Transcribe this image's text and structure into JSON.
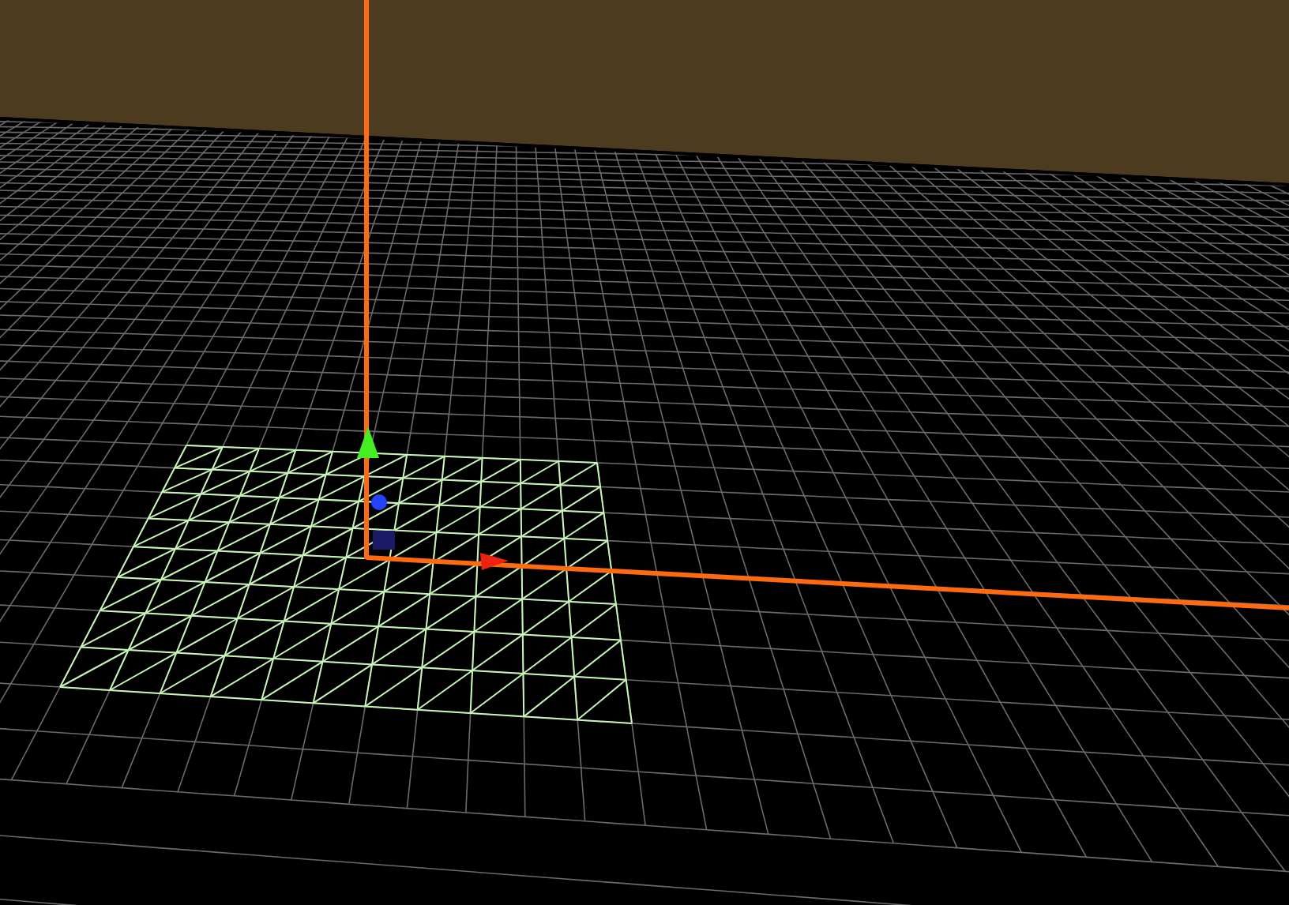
{
  "viewport": {
    "show_grid": true,
    "show_axes": true,
    "show_gizmo": true,
    "mesh_wireframe": true
  }
}
